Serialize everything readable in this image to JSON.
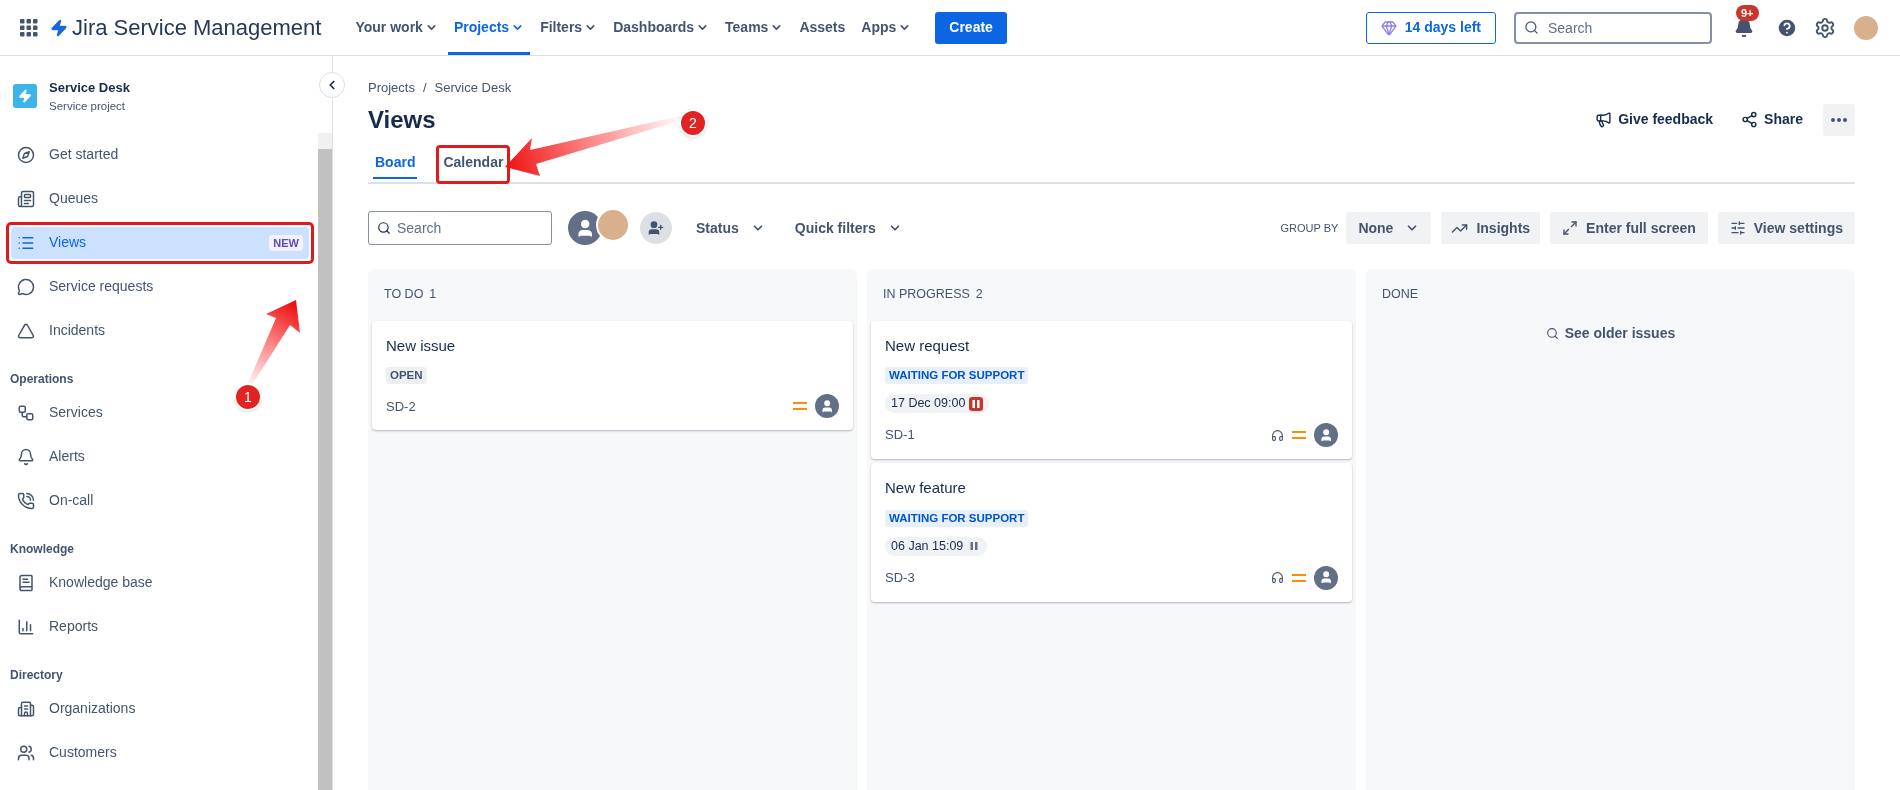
{
  "top_nav": {
    "product": "Jira Service Management",
    "items": [
      {
        "label": "Your work",
        "selected": false,
        "dropdown": true
      },
      {
        "label": "Projects",
        "selected": true,
        "dropdown": true
      },
      {
        "label": "Filters",
        "selected": false,
        "dropdown": true
      },
      {
        "label": "Dashboards",
        "selected": false,
        "dropdown": true
      },
      {
        "label": "Teams",
        "selected": false,
        "dropdown": true
      },
      {
        "label": "Assets",
        "selected": false,
        "dropdown": false
      },
      {
        "label": "Apps",
        "selected": false,
        "dropdown": true
      }
    ],
    "create": "Create",
    "trial": "14 days left",
    "search": {
      "placeholder": "Search"
    },
    "notification_count": "9+"
  },
  "sidebar": {
    "project": {
      "name": "Service Desk",
      "type": "Service project"
    },
    "sections": [
      {
        "items": [
          {
            "label": "Get started",
            "selected": false,
            "highlighted": false
          },
          {
            "label": "Queues",
            "selected": false,
            "highlighted": false
          },
          {
            "label": "Views",
            "selected": true,
            "highlighted": true,
            "badge": "NEW"
          },
          {
            "label": "Service requests",
            "selected": false,
            "highlighted": false
          },
          {
            "label": "Incidents",
            "selected": false,
            "highlighted": false
          }
        ]
      },
      {
        "heading": "Operations",
        "items": [
          {
            "label": "Services",
            "selected": false,
            "highlighted": false
          },
          {
            "label": "Alerts",
            "selected": false,
            "highlighted": false
          },
          {
            "label": "On-call",
            "selected": false,
            "highlighted": false
          }
        ]
      },
      {
        "heading": "Knowledge",
        "items": [
          {
            "label": "Knowledge base",
            "selected": false,
            "highlighted": false
          },
          {
            "label": "Reports",
            "selected": false,
            "highlighted": false
          }
        ]
      },
      {
        "heading": "Directory",
        "items": [
          {
            "label": "Organizations",
            "selected": false,
            "highlighted": false
          },
          {
            "label": "Customers",
            "selected": false,
            "highlighted": false
          }
        ]
      }
    ]
  },
  "breadcrumbs": [
    "Projects",
    "Service Desk"
  ],
  "breadcrumb_separator": "/",
  "title": "Views",
  "header_actions": {
    "feedback": "Give feedback",
    "share": "Share"
  },
  "tabs": [
    {
      "label": "Board",
      "selected": true,
      "highlighted": false
    },
    {
      "label": "Calendar",
      "selected": false,
      "highlighted": true
    }
  ],
  "toolbar": {
    "search": {
      "placeholder": "Search"
    },
    "status": "Status",
    "quick_filters": "Quick filters",
    "group_by_label": "GROUP BY",
    "group_by": "None",
    "insights": "Insights",
    "full_screen": "Enter full screen",
    "view_settings": "View settings"
  },
  "columns": [
    {
      "title": "TO DO",
      "count": "1",
      "cards": [
        {
          "title": "New issue",
          "status": "OPEN",
          "color": "#44546f",
          "key": "SD-2",
          "request_type": false
        }
      ]
    },
    {
      "title": "IN PROGRESS",
      "count": "2",
      "cards": [
        {
          "title": "New request",
          "status": "WAITING FOR SUPPORT",
          "color": "#0055cc",
          "sla": "17 Dec 09:00",
          "sla_breached": true,
          "key": "SD-1",
          "request_type": true
        },
        {
          "title": "New feature",
          "status": "WAITING FOR SUPPORT",
          "color": "#0055cc",
          "sla": "06 Jan 15:09",
          "sla_breached": false,
          "key": "SD-3",
          "request_type": true
        }
      ]
    },
    {
      "title": "DONE",
      "link": "See older issues"
    }
  ],
  "annotations": [
    {
      "number": "1"
    },
    {
      "number": "2"
    }
  ]
}
